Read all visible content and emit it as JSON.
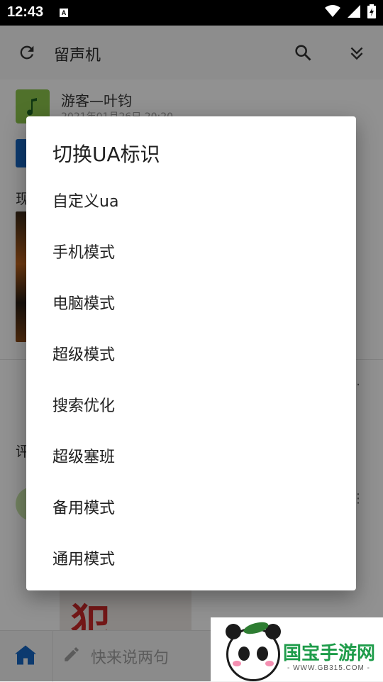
{
  "status_bar": {
    "time": "12:43",
    "notification_badge": "A",
    "icons": [
      "wifi-icon",
      "signal-icon",
      "battery-charging-icon"
    ]
  },
  "app_bar": {
    "title": "留声机",
    "icons": [
      "refresh-icon",
      "search-icon",
      "double-chevron-down-icon"
    ]
  },
  "background_content": {
    "user_name": "游客—叶钧",
    "timestamp": "2021年01月26日 20:20",
    "side_char": "现",
    "comment_label": "评",
    "image_glyph": "犯"
  },
  "bottom_bar": {
    "input_placeholder": "快来说两句"
  },
  "dialog": {
    "title": "切换UA标识",
    "options": [
      "自定义ua",
      "手机模式",
      "电脑模式",
      "超级模式",
      "搜索优化",
      "超级塞班",
      "备用模式",
      "通用模式"
    ]
  },
  "watermark": {
    "brand": "国宝手游网",
    "url": "- WWW.GB315.COM -"
  },
  "colors": {
    "status_bar": "#000000",
    "scrim": "rgba(0,0,0,0.42)",
    "dialog_bg": "#ffffff",
    "brand_green": "#1e9c4a",
    "nav_blue": "#1565c0"
  }
}
